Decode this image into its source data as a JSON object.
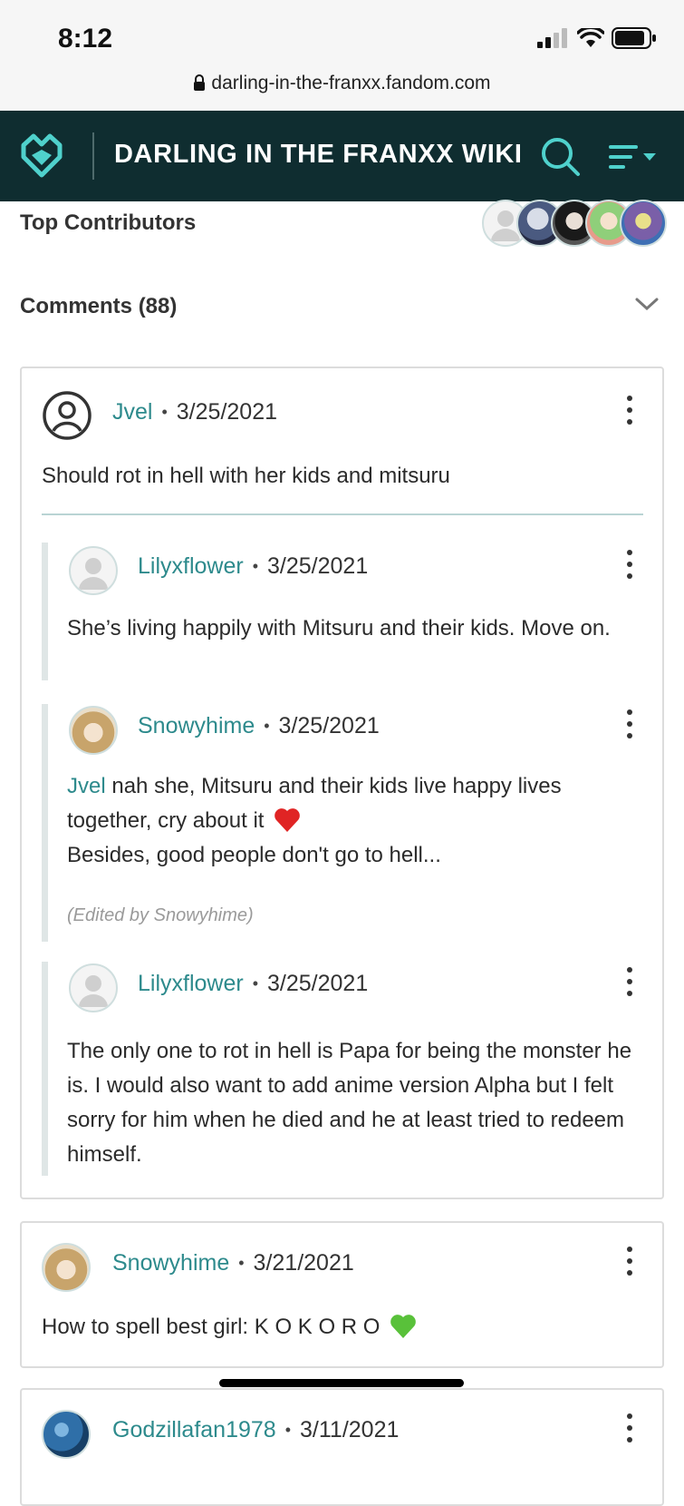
{
  "status": {
    "time": "8:12",
    "url": "darling-in-the-franxx.fandom.com"
  },
  "wiki": {
    "title": "DARLING IN THE FRANXX WIKI"
  },
  "top_contributors": {
    "label": "Top Contributors"
  },
  "comments_section": {
    "label": "Comments (88)"
  },
  "colors": {
    "accent": "#2d8a8c",
    "header_bg": "#0f2d30",
    "heart": "#e02424",
    "green_heart": "#59c13a"
  },
  "comments": [
    {
      "user": "Jvel",
      "date": "3/25/2021",
      "text": "Should rot in hell with her kids and mitsuru",
      "replies": [
        {
          "user": "Lilyxflower",
          "date": "3/25/2021",
          "text": "She’s living happily with Mitsuru and their kids. Move on."
        },
        {
          "user": "Snowyhime",
          "date": "3/25/2021",
          "mention": "Jvel",
          "text": " nah she, Mitsuru and their kids live happy lives together, cry about it",
          "text2": "Besides, good people don't go to hell...",
          "edited": "(Edited by Snowyhime)"
        },
        {
          "user": "Lilyxflower",
          "date": "3/25/2021",
          "text": "The only one to rot in hell is Papa for being the monster he is. I would also want to add anime version Alpha but I felt sorry for him when he died and he at least tried to redeem himself."
        }
      ]
    },
    {
      "user": "Snowyhime",
      "date": "3/21/2021",
      "text": "How to spell best girl: K O K O R O"
    },
    {
      "user": "Godzillafan1978",
      "date": "3/11/2021"
    }
  ]
}
